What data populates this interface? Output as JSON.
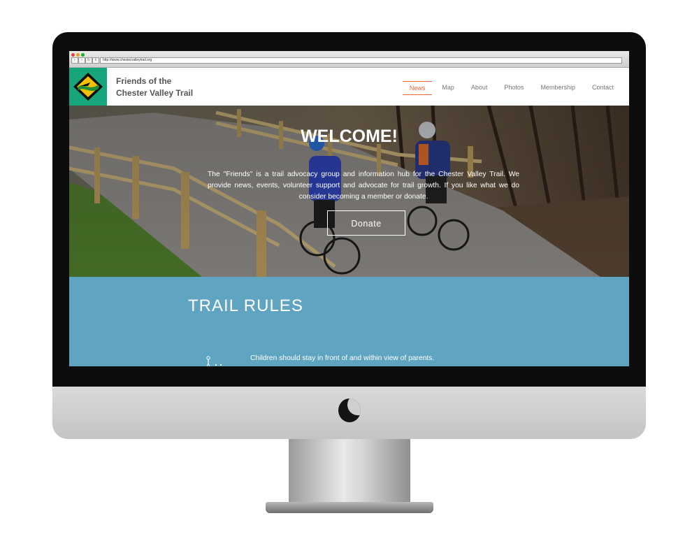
{
  "browser": {
    "url": "http://www.chestervalleytrail.org"
  },
  "site": {
    "brand_line1": "Friends of the",
    "brand_line2": "Chester Valley Trail",
    "logo_icon": "trail-diamond-logo",
    "accent_color": "#e8663a",
    "logo_bg_color": "#17a57c"
  },
  "nav": {
    "items": [
      {
        "label": "News",
        "active": true
      },
      {
        "label": "Map",
        "active": false
      },
      {
        "label": "About",
        "active": false
      },
      {
        "label": "Photos",
        "active": false
      },
      {
        "label": "Membership",
        "active": false
      },
      {
        "label": "Contact",
        "active": false
      }
    ]
  },
  "hero": {
    "title": "WELCOME!",
    "text": "The \"Friends\" is a trail advocacy group and information hub for the Chester Valley Trail. We provide news, events, volunteer support and advocate for trail growth. If you like what we do consider becoming a member or donate.",
    "button": "Donate"
  },
  "rules": {
    "title": "TRAIL RULES",
    "bg_color": "#5fa4c1",
    "items": [
      {
        "icon": "family-walking-icon",
        "text": "Children should stay in front of and within view of parents."
      }
    ]
  }
}
